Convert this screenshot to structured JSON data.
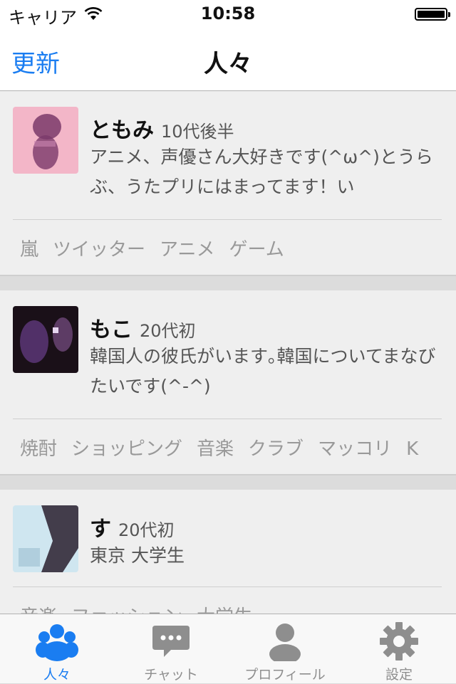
{
  "status_bar": {
    "carrier": "キャリア",
    "time": "10:58",
    "icons": [
      "wifi-icon",
      "battery-icon"
    ]
  },
  "nav": {
    "refresh_label": "更新",
    "title": "人々"
  },
  "people": [
    {
      "name": "ともみ",
      "age": "10代後半",
      "bio": "アニメ、声優さん大好きです(^ω^)とうらぶ、うたプリにはまってます！い",
      "tags": [
        "嵐",
        "ツイッター",
        "アニメ",
        "ゲーム"
      ],
      "avatar_colors": [
        "#f3b6c8",
        "#7a3a6a"
      ]
    },
    {
      "name": "もこ",
      "age": "20代初",
      "bio": "韓国人の彼氏がいます｡韓国についてまなびたいです(^-^)",
      "tags": [
        "焼酎",
        "ショッピング",
        "音楽",
        "クラブ",
        "マッコリ",
        "K"
      ],
      "avatar_colors": [
        "#1a1018",
        "#6a3f8a"
      ]
    },
    {
      "name": "す",
      "age": "20代初",
      "bio": "東京 大学生",
      "tags": [
        "音楽",
        "ファッション",
        "大学生"
      ],
      "avatar_colors": [
        "#cfe6f0",
        "#2a1f2e"
      ]
    }
  ],
  "tabbar": {
    "accent_color": "#1a7df1",
    "inactive_color": "#8e8e8e",
    "tabs": [
      {
        "label": "人々",
        "icon": "people-icon",
        "active": true
      },
      {
        "label": "チャット",
        "icon": "chat-bubble-icon",
        "active": false
      },
      {
        "label": "プロフィール",
        "icon": "profile-icon",
        "active": false
      },
      {
        "label": "設定",
        "icon": "gear-icon",
        "active": false
      }
    ]
  }
}
